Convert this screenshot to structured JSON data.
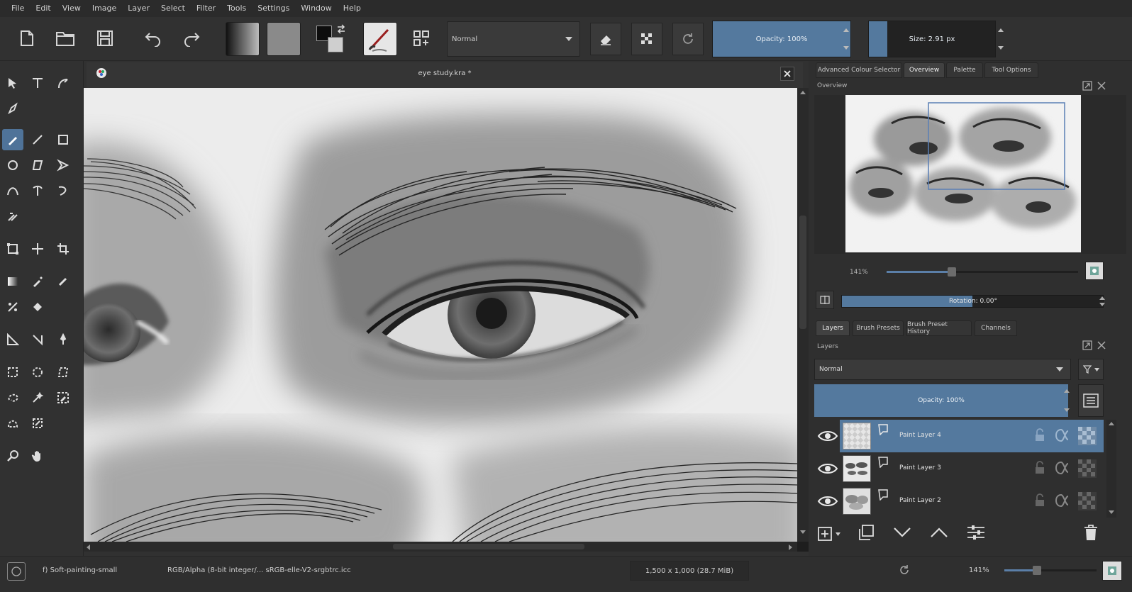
{
  "menubar": {
    "items": [
      "File",
      "Edit",
      "View",
      "Image",
      "Layer",
      "Select",
      "Filter",
      "Tools",
      "Settings",
      "Window",
      "Help"
    ]
  },
  "toolbar": {
    "blend_mode": "Normal",
    "opacity_label": "Opacity: 100%",
    "opacity_value": 1.0,
    "size_label": "Size: 2.91 px"
  },
  "document": {
    "tab_title": "eye study.kra *"
  },
  "dock": {
    "top_tabs": [
      "Advanced Colour Selector",
      "Overview",
      "Palette",
      "Tool Options"
    ],
    "overview_title": "Overview",
    "zoom_label": "141%",
    "rotation_label": "Rotation: 0.00°",
    "rotation_fill": 0.5,
    "bottom_tabs": [
      "Layers",
      "Brush Presets",
      "Brush Preset History",
      "Channels"
    ],
    "layers_title": "Layers",
    "layers_blend": "Normal",
    "layers_opacity": "Opacity: 100%",
    "layers": [
      {
        "name": "Paint Layer 4",
        "selected": true
      },
      {
        "name": "Paint Layer 3",
        "selected": false
      },
      {
        "name": "Paint Layer 2",
        "selected": false
      }
    ]
  },
  "statusbar": {
    "brush": "f) Soft-painting-small",
    "color_space": "RGB/Alpha (8-bit integer/... sRGB-elle-V2-srgbtrc.icc",
    "dimensions": "1,500 x 1,000 (28.7 MiB)",
    "zoom": "141%"
  },
  "colors": {
    "accent": "#54799e",
    "background": "#313131"
  }
}
